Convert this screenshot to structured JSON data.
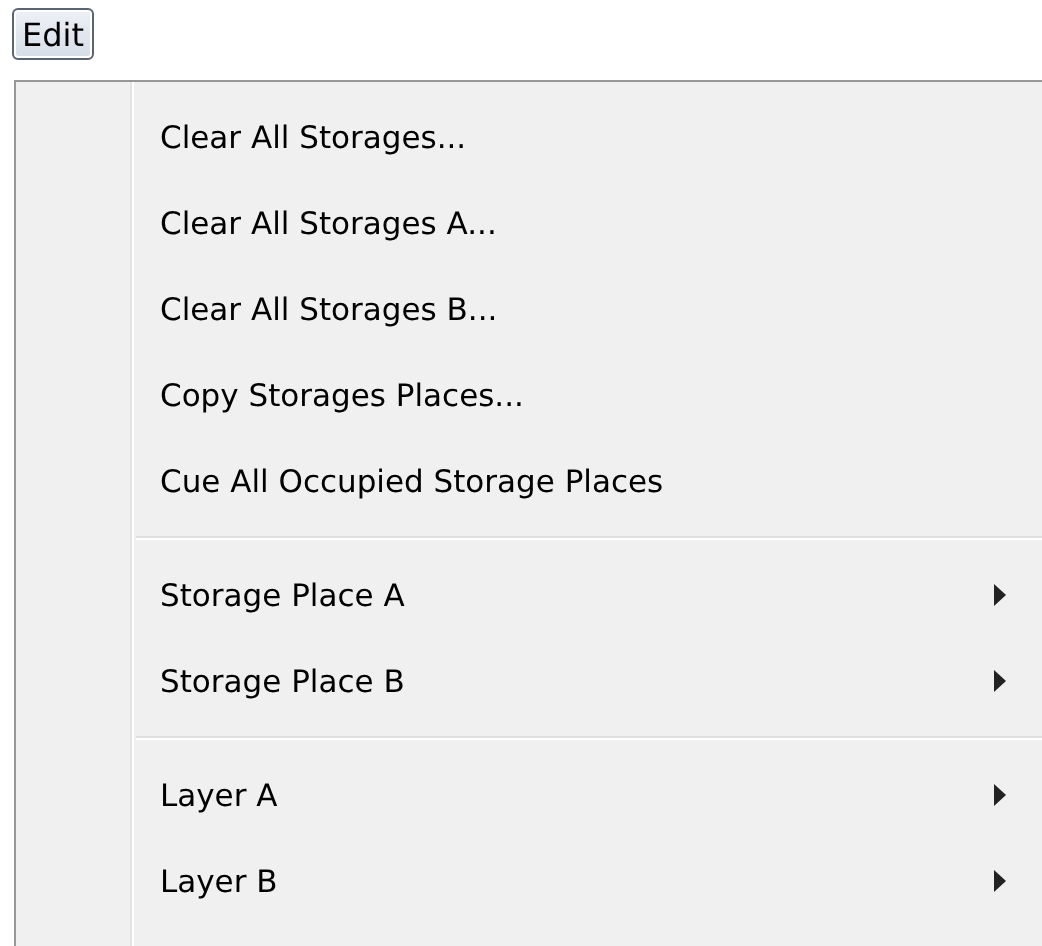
{
  "menubar": [
    {
      "label": "Edit",
      "open": true
    }
  ],
  "menu": {
    "groups": [
      {
        "items": [
          {
            "label": "Clear All Storages...",
            "kind": "command"
          },
          {
            "label": "Clear All Storages A...",
            "kind": "command"
          },
          {
            "label": "Clear All Storages B...",
            "kind": "command"
          },
          {
            "label": "Copy Storages Places...",
            "kind": "command"
          },
          {
            "label": "Cue All Occupied Storage Places",
            "kind": "command"
          }
        ]
      },
      {
        "items": [
          {
            "label": "Storage Place A",
            "kind": "submenu"
          },
          {
            "label": "Storage Place B",
            "kind": "submenu"
          }
        ]
      },
      {
        "items": [
          {
            "label": "Layer A",
            "kind": "submenu"
          },
          {
            "label": "Layer B",
            "kind": "submenu"
          }
        ]
      }
    ]
  }
}
